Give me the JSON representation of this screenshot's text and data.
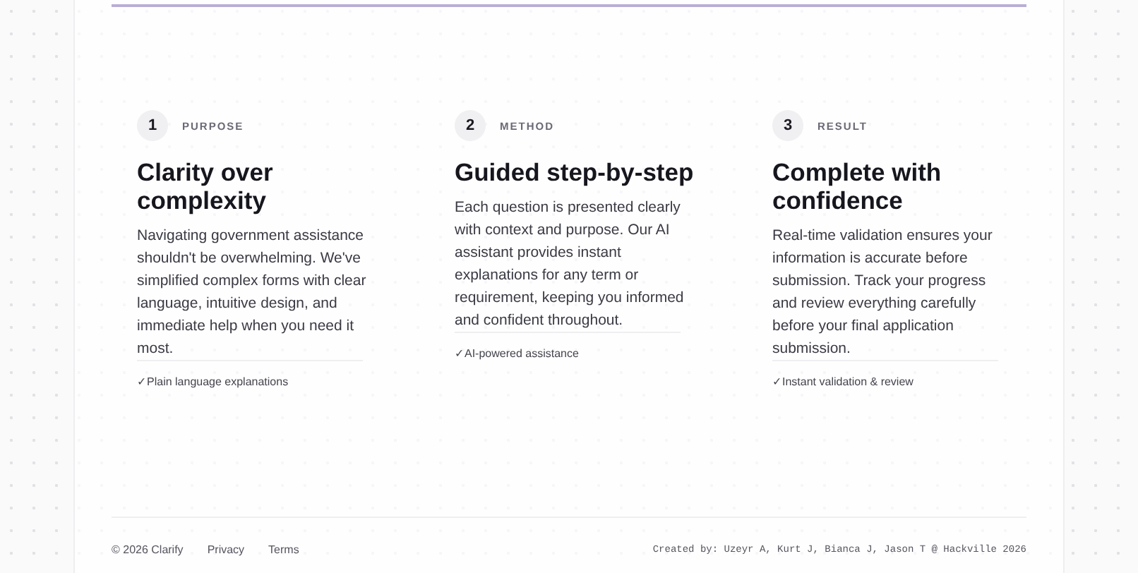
{
  "steps": [
    {
      "number": "1",
      "label": "PURPOSE",
      "title": "Clarity over complexity",
      "body": "Navigating government assistance shouldn't be overwhelming. We've simplified complex forms with clear language, intuitive design, and immediate help when you need it most.",
      "feature": "✓Plain language explanations"
    },
    {
      "number": "2",
      "label": "METHOD",
      "title": "Guided step-by-step",
      "body": "Each question is presented clearly with context and purpose. Our AI assistant provides instant explanations for any term or requirement, keeping you informed and confident throughout.",
      "feature": "✓AI-powered assistance"
    },
    {
      "number": "3",
      "label": "RESULT",
      "title": "Complete with confidence",
      "body": "Real-time validation ensures your information is accurate before submission. Track your progress and review everything carefully before your final application submission.",
      "feature": "✓Instant validation & review"
    }
  ],
  "footer": {
    "copyright": "© 2026 Clarify",
    "links": [
      "Privacy",
      "Terms"
    ],
    "credits": "Created by: Uzeyr A, Kurt J, Bianca J, Jason T @ Hackville 2026"
  }
}
